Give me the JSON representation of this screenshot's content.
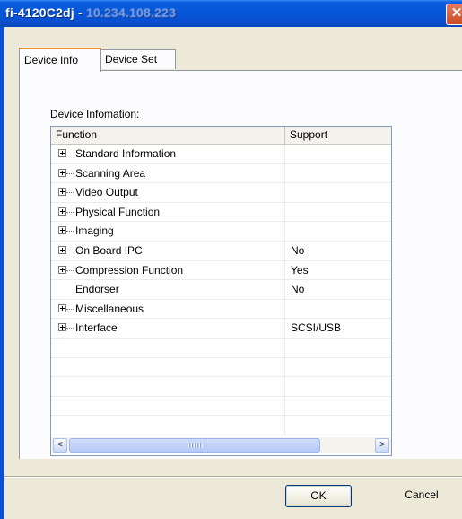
{
  "window": {
    "title_prefix": "fi-4120C2dj - ",
    "title_ip": "10.234.108.223",
    "close_glyph": "✕"
  },
  "tabs": [
    {
      "label": "Device Info",
      "active": true
    },
    {
      "label": "Device Set",
      "active": false
    }
  ],
  "group": {
    "label": "Device Infomation:"
  },
  "list": {
    "columns": [
      "Function",
      "Support"
    ],
    "rows": [
      {
        "function": "Standard Information",
        "support": "",
        "expandable": true
      },
      {
        "function": "Scanning Area",
        "support": "",
        "expandable": true
      },
      {
        "function": "Video Output",
        "support": "",
        "expandable": true
      },
      {
        "function": "Physical Function",
        "support": "",
        "expandable": true
      },
      {
        "function": "Imaging",
        "support": "",
        "expandable": true
      },
      {
        "function": "On Board IPC",
        "support": "No",
        "expandable": true
      },
      {
        "function": "Compression Function",
        "support": "Yes",
        "expandable": true
      },
      {
        "function": "Endorser",
        "support": "No",
        "expandable": false
      },
      {
        "function": "Miscellaneous",
        "support": "",
        "expandable": true
      },
      {
        "function": "Interface",
        "support": "SCSI/USB",
        "expandable": true
      },
      {
        "function": "",
        "support": "",
        "expandable": false
      },
      {
        "function": "",
        "support": "",
        "expandable": false
      },
      {
        "function": "",
        "support": "",
        "expandable": false
      },
      {
        "function": "",
        "support": "",
        "expandable": false
      },
      {
        "function": "",
        "support": "",
        "expandable": false
      }
    ]
  },
  "scrollbar": {
    "left_glyph": "<",
    "right_glyph": ">"
  },
  "buttons": {
    "ok": "OK",
    "cancel": "Cancel"
  }
}
